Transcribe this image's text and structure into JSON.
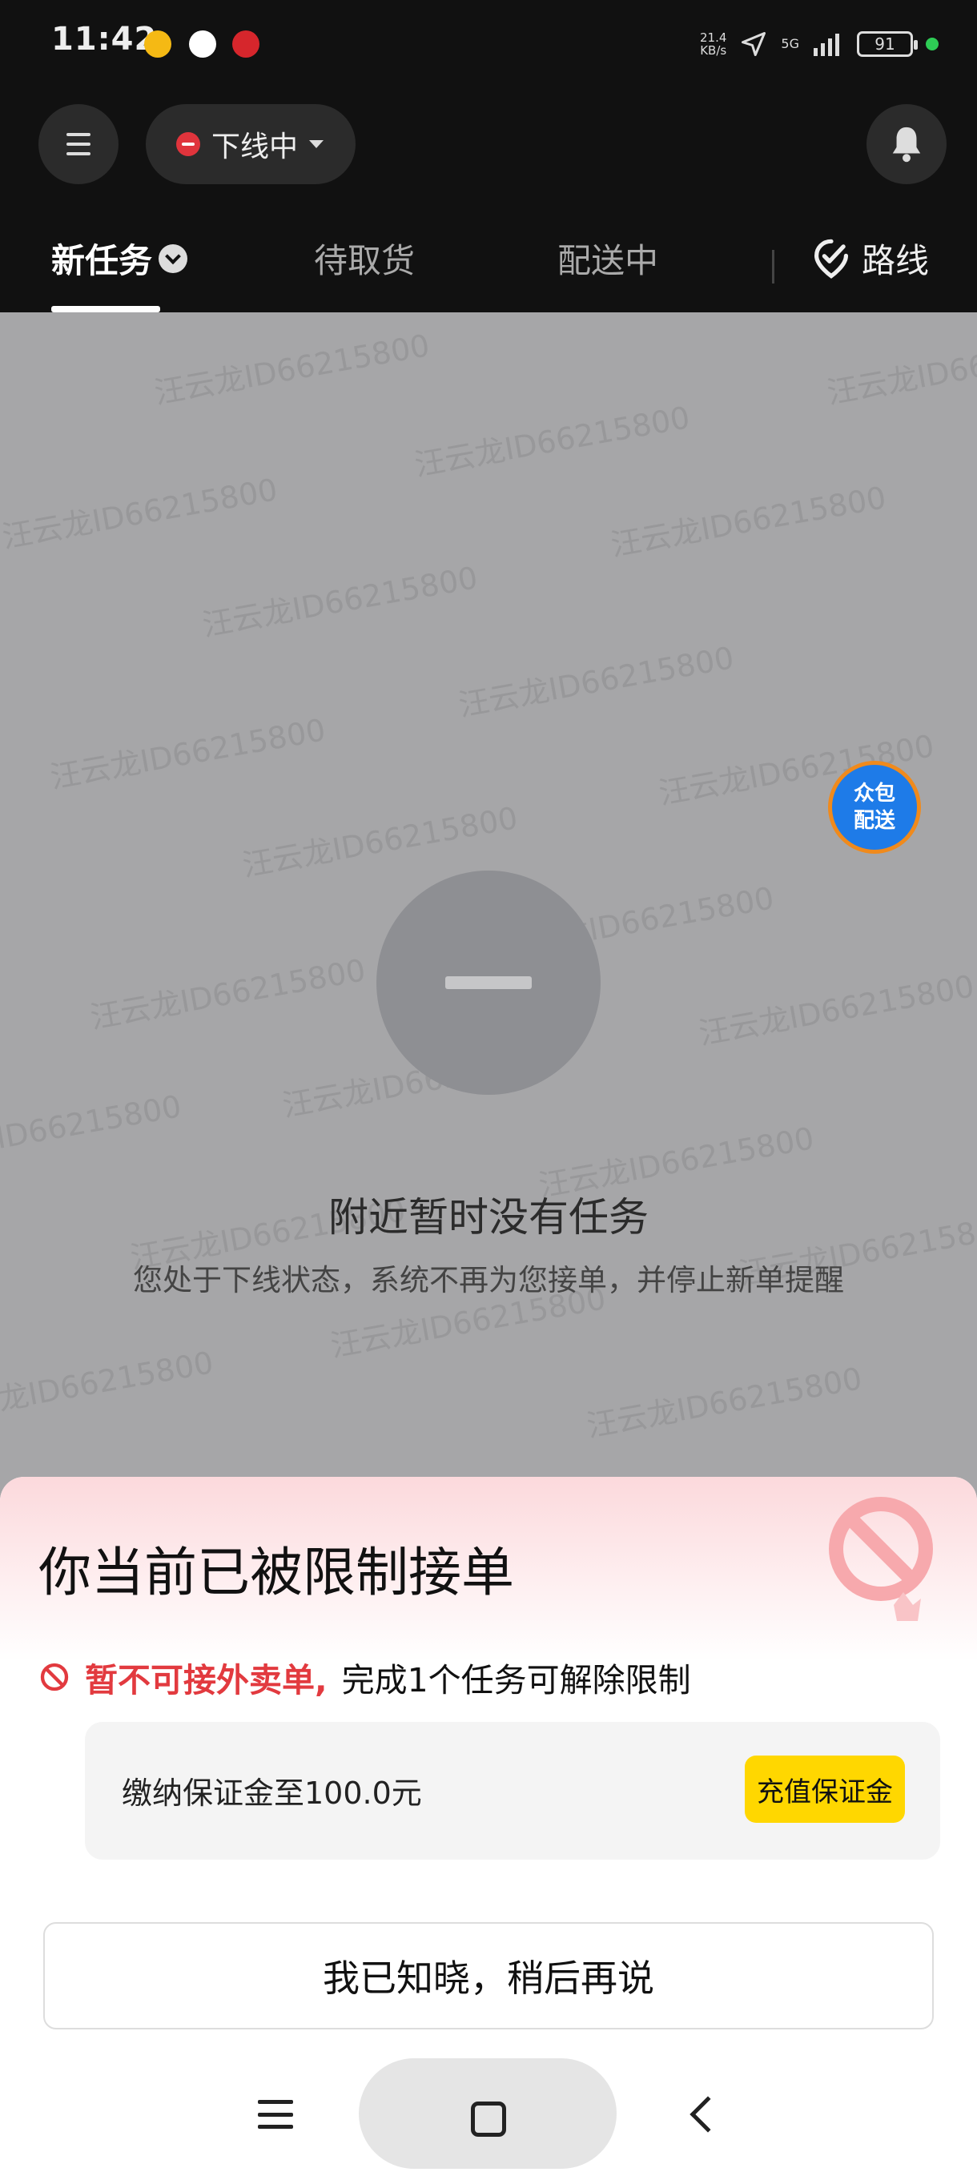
{
  "status_bar": {
    "time": "11:42",
    "net_speed_value": "21.4",
    "net_speed_unit": "KB/s",
    "network": "5G",
    "battery": "91",
    "icons": [
      "yellow-app-icon",
      "android-icon",
      "red-app-icon",
      "location-arrow-icon",
      "signal-icon",
      "battery-icon"
    ]
  },
  "header": {
    "status_label": "下线中",
    "icons": [
      "menu-icon",
      "offline-icon",
      "bell-icon"
    ]
  },
  "tabs": {
    "new_tasks": "新任务",
    "pickup": "待取货",
    "delivering": "配送中",
    "route": "路线"
  },
  "content": {
    "watermark": "汪云龙ID66215800",
    "crowd_badge_line1": "众包",
    "crowd_badge_line2": "配送",
    "empty_title": "附近暂时没有任务",
    "empty_subtitle": "您处于下线状态，系统不再为您接单，并停止新单提醒"
  },
  "sheet": {
    "title": "你当前已被限制接单",
    "restrict_red": "暂不可接外卖单,",
    "restrict_black": "完成1个任务可解除限制",
    "deposit_text": "缴纳保证金至100.0元",
    "recharge_label": "充值保证金",
    "ack_label": "我已知晓，稍后再说"
  },
  "colors": {
    "accent_red": "#e23a3f",
    "button_yellow": "#ffd700",
    "crowd_blue": "#1e7be8"
  }
}
